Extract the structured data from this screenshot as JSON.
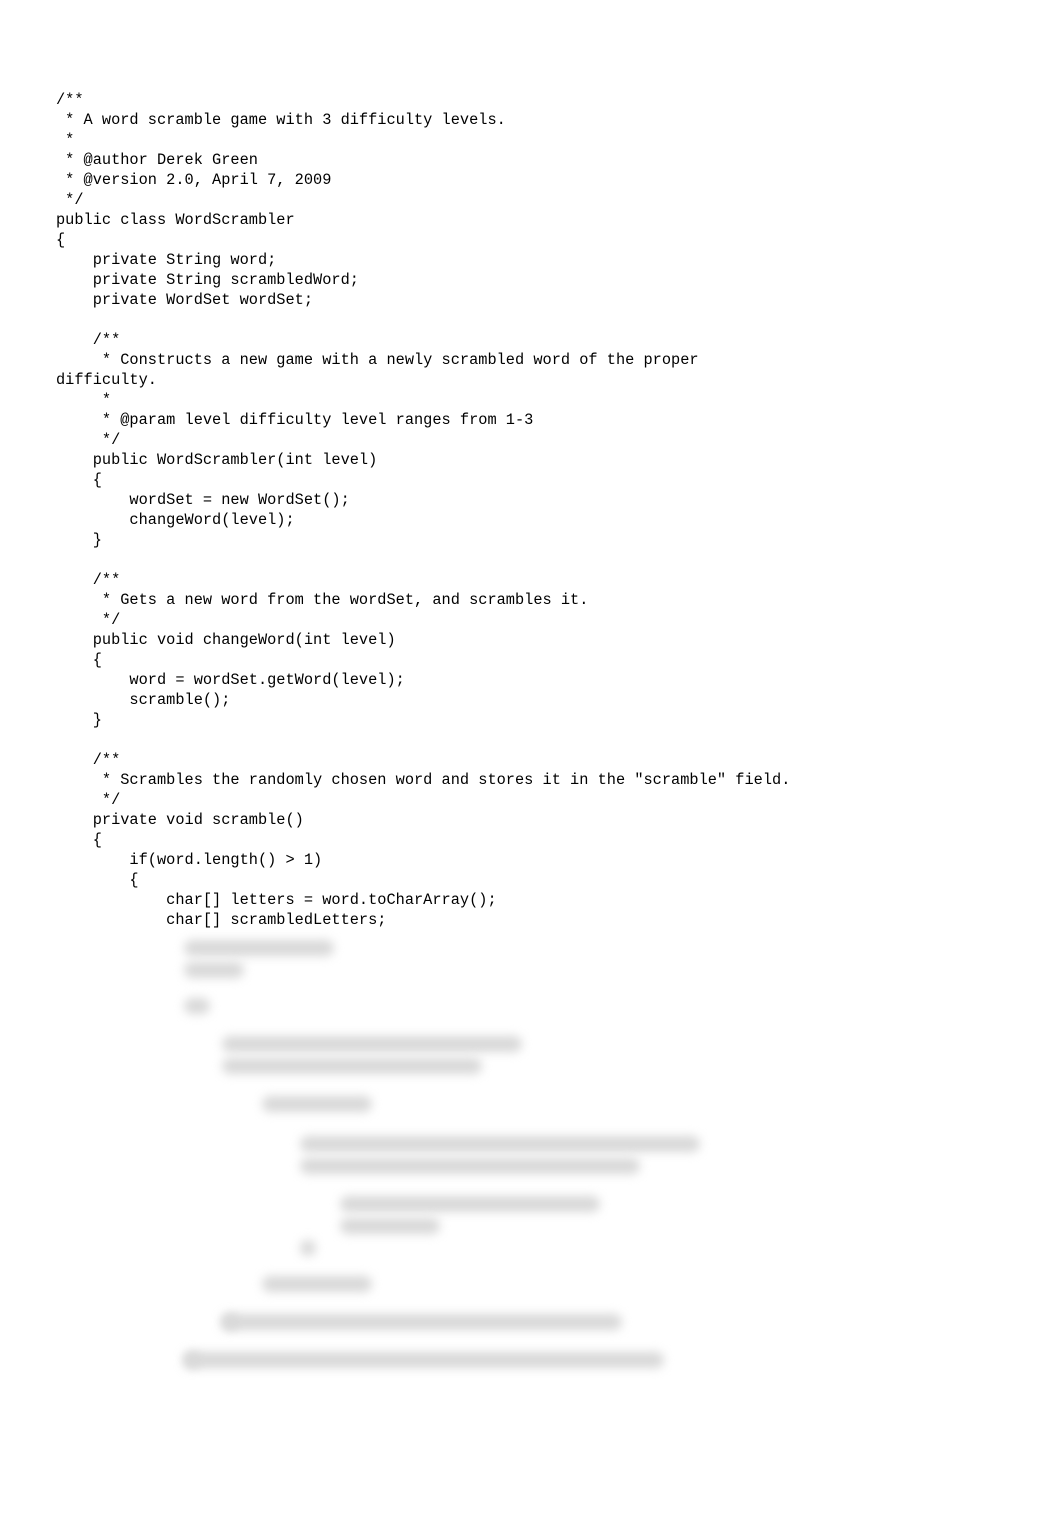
{
  "code": {
    "lines": [
      "/**",
      " * A word scramble game with 3 difficulty levels.",
      " * ",
      " * @author Derek Green",
      " * @version 2.0, April 7, 2009",
      " */",
      "public class WordScrambler",
      "{",
      "    private String word;",
      "    private String scrambledWord;",
      "    private WordSet wordSet;",
      "",
      "    /**",
      "     * Constructs a new game with a newly scrambled word of the proper ",
      "difficulty.",
      "     * ",
      "     * @param level difficulty level ranges from 1-3",
      "     */",
      "    public WordScrambler(int level)",
      "    {",
      "        wordSet = new WordSet();",
      "        changeWord(level);",
      "    }",
      "    ",
      "    /**",
      "     * Gets a new word from the wordSet, and scrambles it.",
      "     */",
      "    public void changeWord(int level)",
      "    {",
      "        word = wordSet.getWord(level);",
      "        scramble();",
      "    }",
      "    ",
      "    /**",
      "     * Scrambles the randomly chosen word and stores it in the \"scramble\" field.",
      "     */ ",
      "    private void scramble()",
      "    {",
      "        if(word.length() > 1)",
      "        {",
      "            char[] letters = word.toCharArray();",
      "            char[] scrambledLetters;"
    ]
  },
  "hidden": {
    "note": "Blurred/obscured code region below visible lines"
  }
}
